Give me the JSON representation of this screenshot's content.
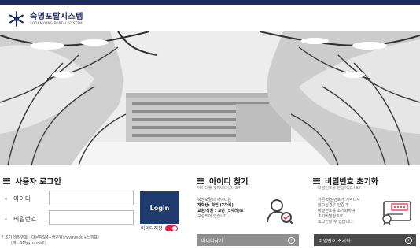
{
  "header": {
    "logo_title": "숙명포탈시스템",
    "logo_subtitle": "SOOKMYUNG PORTAL SYSTEM",
    "logo_icon": "snowflake-emblem-icon",
    "brand_color": "#1e2b5e"
  },
  "login": {
    "title": "사용자 로그인",
    "id_label": "아이디",
    "pw_label": "비밀번호",
    "login_button": "Login",
    "save_id_label": "아이디저장",
    "save_id_on": true,
    "note_line1": "* 초기 비밀번호 : 대문자SM+생년월일yymmdd+느낌표!",
    "note_line2": "(예 : SMyymmdd!)"
  },
  "find_id": {
    "title": "아이디 찾기",
    "question": "아이디를 잊어버리셨나요?",
    "body_line1": "숙명포탈의 아이디는",
    "body_line2": "재학생: 학번 (7자리)",
    "body_line3": "교원/직원 : 교번 (5자리)로",
    "body_line4": "구성되어 있습니다.",
    "button": "아이디찾기",
    "icon": "user-search-icon"
  },
  "reset_pw": {
    "title": "비밀번호 초기화",
    "question": "비밀번호를 분실하셨나요?",
    "body_line1": "기존 비밀번호가 기억나지",
    "body_line2": "않으실경우 인증 후",
    "body_line3": "비밀번호를 초기화하여",
    "body_line4": "초기비밀번호로",
    "body_line5": "로그인할 수 있습니다.",
    "button": "비밀번호 초기화",
    "icon": "password-certificate-icon"
  }
}
